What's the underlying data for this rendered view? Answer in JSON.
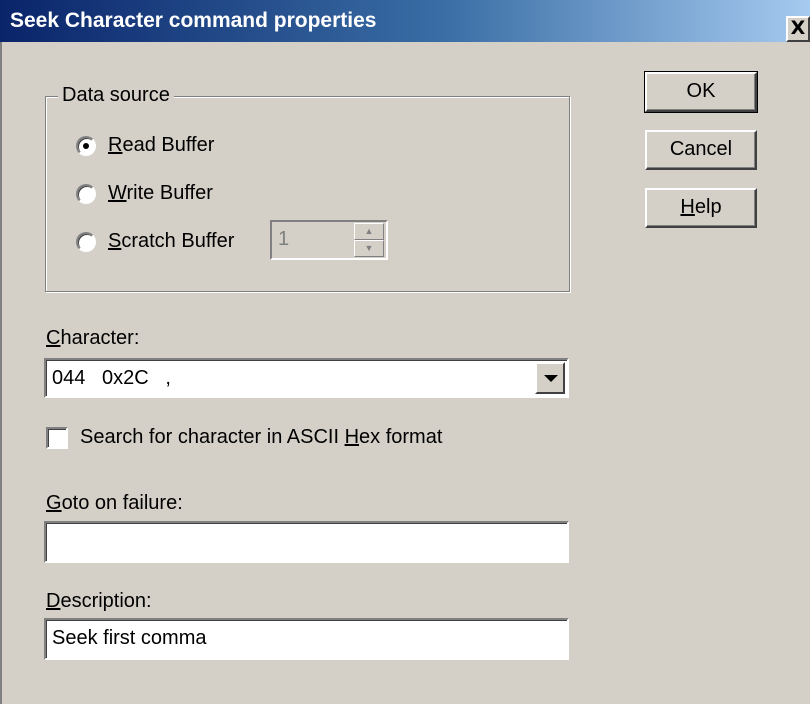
{
  "window": {
    "title": "Seek Character command properties",
    "close_label": "X"
  },
  "data_source": {
    "legend": "Data source",
    "options": [
      {
        "mnemonic": "R",
        "rest": "ead Buffer",
        "selected": true
      },
      {
        "mnemonic": "W",
        "rest": "rite Buffer",
        "selected": false
      },
      {
        "mnemonic": "S",
        "rest": "cratch Buffer",
        "selected": false
      }
    ],
    "scratch_index": "1"
  },
  "buttons": {
    "ok": "OK",
    "cancel": "Cancel",
    "help_mnemonic": "H",
    "help_rest": "elp"
  },
  "character": {
    "label_mnemonic": "C",
    "label_rest": "haracter:",
    "value": "044   0x2C   ,"
  },
  "ascii_hex": {
    "label_pre": "Search for character in ASCII ",
    "label_mnemonic": "H",
    "label_post": "ex format",
    "checked": false
  },
  "goto": {
    "label_mnemonic": "G",
    "label_rest": "oto on failure:",
    "value": ""
  },
  "description": {
    "label_mnemonic": "D",
    "label_rest": "escription:",
    "value": "Seek first comma"
  }
}
